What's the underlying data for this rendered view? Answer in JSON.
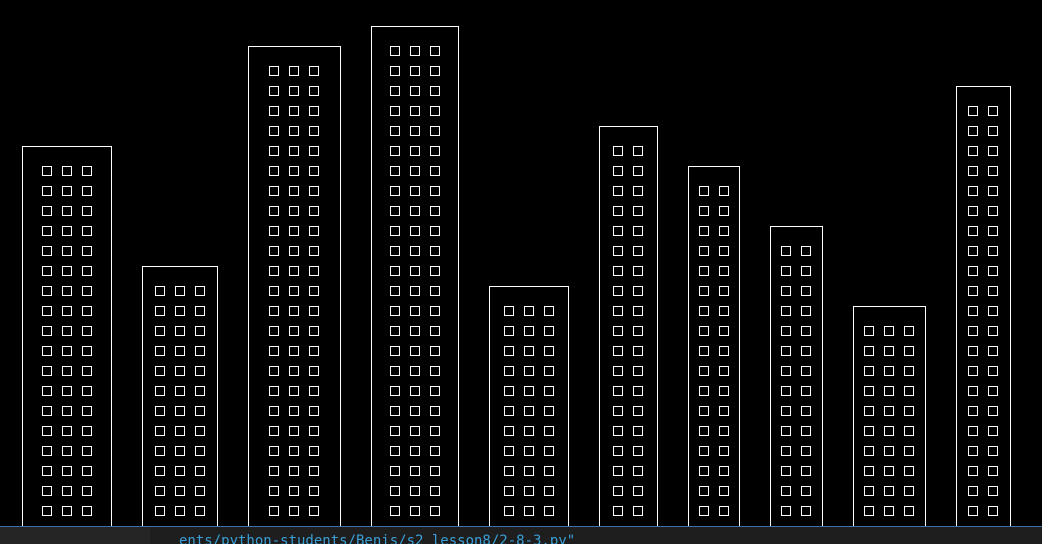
{
  "window": {
    "title": ""
  },
  "scene": {
    "background_color": "#000000",
    "stroke_color": "#ffffff",
    "buildings": [
      {
        "id": 1,
        "window_columns": 3,
        "window_rows": 18
      },
      {
        "id": 2,
        "window_columns": 3,
        "window_rows": 12
      },
      {
        "id": 3,
        "window_columns": 3,
        "window_rows": 23
      },
      {
        "id": 4,
        "window_columns": 3,
        "window_rows": 24
      },
      {
        "id": 5,
        "window_columns": 3,
        "window_rows": 11
      },
      {
        "id": 6,
        "window_columns": 2,
        "window_rows": 19
      },
      {
        "id": 7,
        "window_columns": 2,
        "window_rows": 17
      },
      {
        "id": 8,
        "window_columns": 2,
        "window_rows": 14
      },
      {
        "id": 9,
        "window_columns": 3,
        "window_rows": 10
      },
      {
        "id": 10,
        "window_columns": 2,
        "window_rows": 21
      }
    ]
  },
  "terminal": {
    "path_text": "ents/python-students/Benis/s2_lesson8/2-8-3.py\"",
    "text_color": "#3a9fd6",
    "background_color": "#1e1e1e",
    "border_color": "#3f6fa8"
  }
}
